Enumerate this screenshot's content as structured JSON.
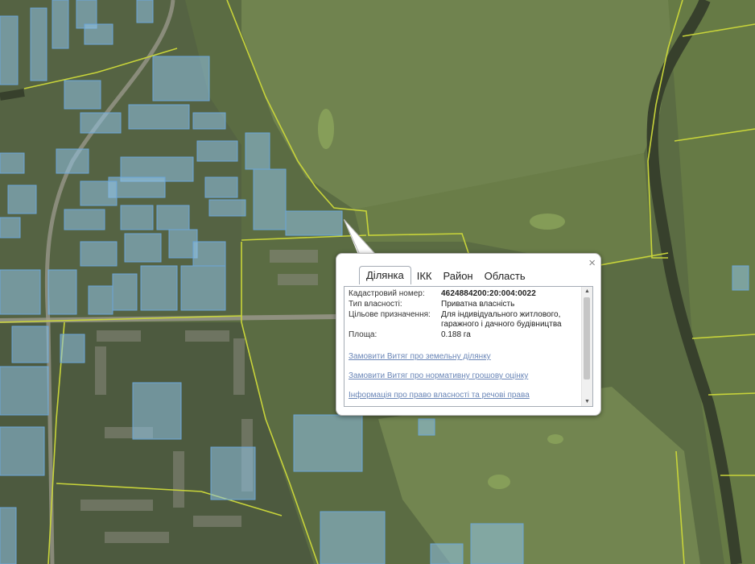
{
  "map": {
    "colors": {
      "ground": "#5d6e45",
      "field": "#70834f",
      "boundary": "#c8d43a",
      "parcel_fill": "#8fc3e6",
      "parcel_stroke": "#6aa6d8",
      "river": "#37402c"
    }
  },
  "popup": {
    "close_label": "×",
    "tabs": [
      {
        "label": "Ділянка",
        "active": true
      },
      {
        "label": "ІКК",
        "active": false
      },
      {
        "label": "Район",
        "active": false
      },
      {
        "label": "Область",
        "active": false
      }
    ],
    "fields": {
      "cadastral_number": {
        "label": "Кадастровий номер:",
        "value": "4624884200:20:004:0022"
      },
      "ownership_type": {
        "label": "Тип власності:",
        "value": "Приватна власність"
      },
      "purpose": {
        "label": "Цільове призначення:",
        "value": "Для індивідуального житлового, гаражного і дачного будівництва"
      },
      "area": {
        "label": "Площа:",
        "value": "0.188 га"
      }
    },
    "links": {
      "land_extract": "Замовити Витяг про земельну ділянку",
      "normative_valuation": "Замовити Витяг про нормативну грошову оцінку",
      "ownership_info": "Інформація про право власності та речові права"
    },
    "scrollbar": {
      "up_icon": "arrow-up-icon",
      "down_icon": "arrow-down-icon"
    }
  }
}
